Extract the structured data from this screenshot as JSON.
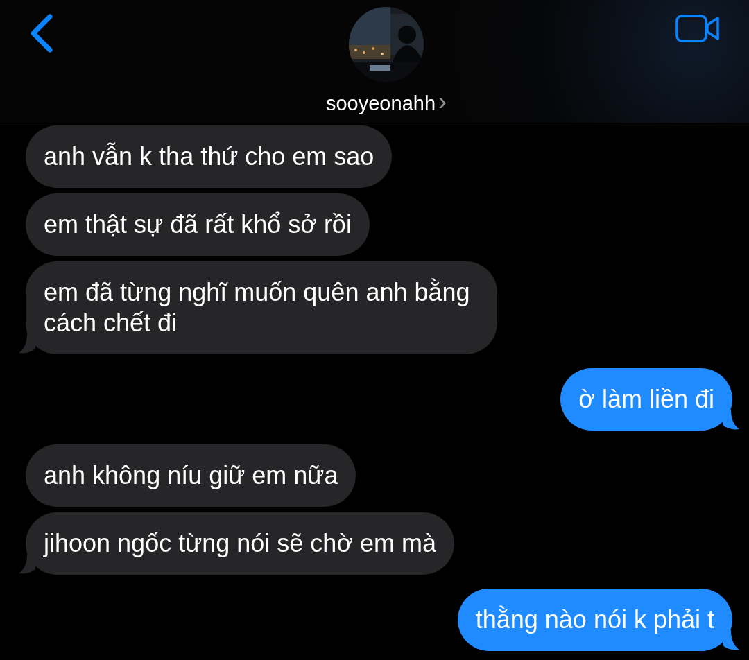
{
  "header": {
    "contact_name": "sooyeonahh",
    "chevron": "›"
  },
  "messages": [
    {
      "kind": "received",
      "text": "anh vẫn k tha thứ cho em sao",
      "tail": false
    },
    {
      "kind": "received",
      "text": "em thật sự đã rất khổ sở rồi",
      "tail": false
    },
    {
      "kind": "received",
      "text": "em đã từng nghĩ muốn quên anh bằng cách chết đi",
      "tail": true
    },
    {
      "kind": "sent",
      "text": "ờ làm liền đi",
      "tail": true
    },
    {
      "kind": "received",
      "text": "anh không níu giữ em nữa",
      "tail": false
    },
    {
      "kind": "received",
      "text": "jihoon ngốc từng nói sẽ chờ em mà",
      "tail": true
    },
    {
      "kind": "sent",
      "text": "thằng nào nói k phải t",
      "tail": true
    }
  ]
}
